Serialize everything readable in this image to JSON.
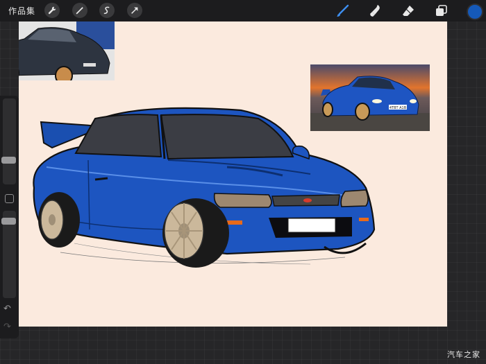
{
  "toolbar": {
    "gallery_label": "作品集",
    "left_tools": [
      "wrench-icon",
      "magic-wand-icon",
      "selection-icon",
      "transform-arrow-icon"
    ],
    "right_tools": [
      "brush-icon",
      "smudge-icon",
      "eraser-icon",
      "layers-icon"
    ],
    "active_tool": "brush-icon",
    "current_color": "#1559b8"
  },
  "sidebar": {
    "brush_size_slider": "brush-size-slider",
    "opacity_slider": "opacity-slider",
    "undo_glyph": "↶",
    "redo_glyph": "↷"
  },
  "references": {
    "ref1_plate": "",
    "ref2_plate": "4TBT A1B"
  },
  "watermark": "汽车之家"
}
